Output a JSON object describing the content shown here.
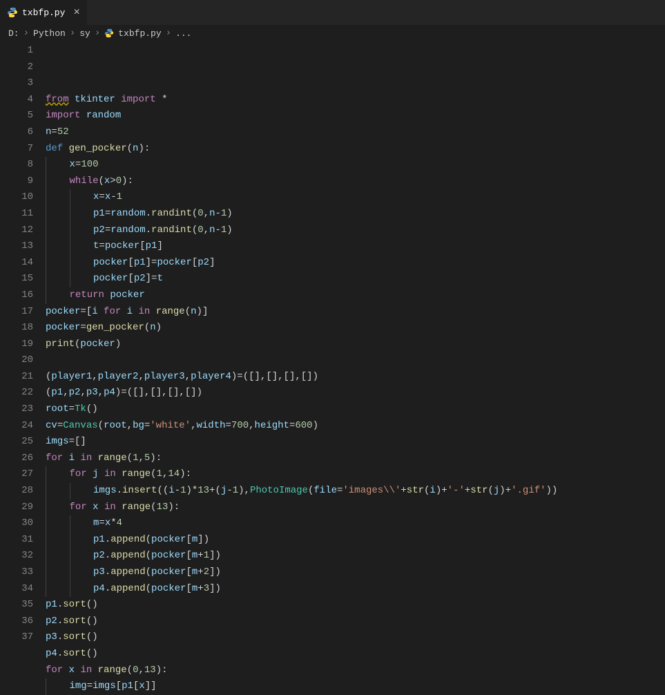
{
  "tab": {
    "filename": "txbfp.py",
    "close_glyph": "×"
  },
  "breadcrumb": {
    "parts": [
      "D:",
      "Python",
      "sy",
      "txbfp.py",
      "..."
    ],
    "sep": "›"
  },
  "gutter_start": 1,
  "gutter_end": 37,
  "code_lines": [
    [
      [
        "kw squig",
        "from"
      ],
      [
        "op",
        " "
      ],
      [
        "var",
        "tkinter"
      ],
      [
        "op",
        " "
      ],
      [
        "kw",
        "import"
      ],
      [
        "op",
        " "
      ],
      [
        "op",
        "*"
      ]
    ],
    [
      [
        "kw",
        "import"
      ],
      [
        "op",
        " "
      ],
      [
        "var",
        "random"
      ]
    ],
    [
      [
        "var",
        "n"
      ],
      [
        "op",
        "="
      ],
      [
        "num",
        "52"
      ]
    ],
    [
      [
        "kw2",
        "def"
      ],
      [
        "op",
        " "
      ],
      [
        "fn",
        "gen_pocker"
      ],
      [
        "par",
        "("
      ],
      [
        "var",
        "n"
      ],
      [
        "par",
        ")"
      ],
      [
        "pun",
        ":"
      ]
    ],
    [
      [
        "ind",
        1
      ],
      [
        "var",
        "x"
      ],
      [
        "op",
        "="
      ],
      [
        "num",
        "100"
      ]
    ],
    [
      [
        "ind",
        1
      ],
      [
        "kw",
        "while"
      ],
      [
        "par",
        "("
      ],
      [
        "var",
        "x"
      ],
      [
        "op",
        ">"
      ],
      [
        "num",
        "0"
      ],
      [
        "par",
        ")"
      ],
      [
        "pun",
        ":"
      ]
    ],
    [
      [
        "ind",
        2
      ],
      [
        "var",
        "x"
      ],
      [
        "op",
        "="
      ],
      [
        "var",
        "x"
      ],
      [
        "op",
        "-"
      ],
      [
        "num",
        "1"
      ]
    ],
    [
      [
        "ind",
        2
      ],
      [
        "var",
        "p1"
      ],
      [
        "op",
        "="
      ],
      [
        "var",
        "random"
      ],
      [
        "pun",
        "."
      ],
      [
        "fn",
        "randint"
      ],
      [
        "par",
        "("
      ],
      [
        "num",
        "0"
      ],
      [
        "pun",
        ","
      ],
      [
        "var",
        "n"
      ],
      [
        "op",
        "-"
      ],
      [
        "num",
        "1"
      ],
      [
        "par",
        ")"
      ]
    ],
    [
      [
        "ind",
        2
      ],
      [
        "var",
        "p2"
      ],
      [
        "op",
        "="
      ],
      [
        "var",
        "random"
      ],
      [
        "pun",
        "."
      ],
      [
        "fn",
        "randint"
      ],
      [
        "par",
        "("
      ],
      [
        "num",
        "0"
      ],
      [
        "pun",
        ","
      ],
      [
        "var",
        "n"
      ],
      [
        "op",
        "-"
      ],
      [
        "num",
        "1"
      ],
      [
        "par",
        ")"
      ]
    ],
    [
      [
        "ind",
        2
      ],
      [
        "var",
        "t"
      ],
      [
        "op",
        "="
      ],
      [
        "var",
        "pocker"
      ],
      [
        "par",
        "["
      ],
      [
        "var",
        "p1"
      ],
      [
        "par",
        "]"
      ]
    ],
    [
      [
        "ind",
        2
      ],
      [
        "var",
        "pocker"
      ],
      [
        "par",
        "["
      ],
      [
        "var",
        "p1"
      ],
      [
        "par",
        "]"
      ],
      [
        "op",
        "="
      ],
      [
        "var",
        "pocker"
      ],
      [
        "par",
        "["
      ],
      [
        "var",
        "p2"
      ],
      [
        "par",
        "]"
      ]
    ],
    [
      [
        "ind",
        2
      ],
      [
        "var",
        "pocker"
      ],
      [
        "par",
        "["
      ],
      [
        "var",
        "p2"
      ],
      [
        "par",
        "]"
      ],
      [
        "op",
        "="
      ],
      [
        "var",
        "t"
      ]
    ],
    [
      [
        "ind",
        1
      ],
      [
        "kw",
        "return"
      ],
      [
        "op",
        " "
      ],
      [
        "var",
        "pocker"
      ]
    ],
    [
      [
        "var",
        "pocker"
      ],
      [
        "op",
        "="
      ],
      [
        "par",
        "["
      ],
      [
        "var",
        "i"
      ],
      [
        "op",
        " "
      ],
      [
        "kw",
        "for"
      ],
      [
        "op",
        " "
      ],
      [
        "var",
        "i"
      ],
      [
        "op",
        " "
      ],
      [
        "kw",
        "in"
      ],
      [
        "op",
        " "
      ],
      [
        "fn",
        "range"
      ],
      [
        "par",
        "("
      ],
      [
        "var",
        "n"
      ],
      [
        "par",
        ")"
      ],
      [
        "par",
        "]"
      ]
    ],
    [
      [
        "var",
        "pocker"
      ],
      [
        "op",
        "="
      ],
      [
        "fn",
        "gen_pocker"
      ],
      [
        "par",
        "("
      ],
      [
        "var",
        "n"
      ],
      [
        "par",
        ")"
      ]
    ],
    [
      [
        "fn",
        "print"
      ],
      [
        "par",
        "("
      ],
      [
        "var",
        "pocker"
      ],
      [
        "par",
        ")"
      ]
    ],
    [],
    [
      [
        "par",
        "("
      ],
      [
        "var",
        "player1"
      ],
      [
        "pun",
        ","
      ],
      [
        "var",
        "player2"
      ],
      [
        "pun",
        ","
      ],
      [
        "var",
        "player3"
      ],
      [
        "pun",
        ","
      ],
      [
        "var",
        "player4"
      ],
      [
        "par",
        ")"
      ],
      [
        "op",
        "="
      ],
      [
        "par",
        "("
      ],
      [
        "par",
        "["
      ],
      [
        "par",
        "]"
      ],
      [
        "pun",
        ","
      ],
      [
        "par",
        "["
      ],
      [
        "par",
        "]"
      ],
      [
        "pun",
        ","
      ],
      [
        "par",
        "["
      ],
      [
        "par",
        "]"
      ],
      [
        "pun",
        ","
      ],
      [
        "par",
        "["
      ],
      [
        "par",
        "]"
      ],
      [
        "par",
        ")"
      ]
    ],
    [
      [
        "par",
        "("
      ],
      [
        "var",
        "p1"
      ],
      [
        "pun",
        ","
      ],
      [
        "var",
        "p2"
      ],
      [
        "pun",
        ","
      ],
      [
        "var",
        "p3"
      ],
      [
        "pun",
        ","
      ],
      [
        "var",
        "p4"
      ],
      [
        "par",
        ")"
      ],
      [
        "op",
        "="
      ],
      [
        "par",
        "("
      ],
      [
        "par",
        "["
      ],
      [
        "par",
        "]"
      ],
      [
        "pun",
        ","
      ],
      [
        "par",
        "["
      ],
      [
        "par",
        "]"
      ],
      [
        "pun",
        ","
      ],
      [
        "par",
        "["
      ],
      [
        "par",
        "]"
      ],
      [
        "pun",
        ","
      ],
      [
        "par",
        "["
      ],
      [
        "par",
        "]"
      ],
      [
        "par",
        ")"
      ]
    ],
    [
      [
        "var",
        "root"
      ],
      [
        "op",
        "="
      ],
      [
        "cls",
        "Tk"
      ],
      [
        "par",
        "("
      ],
      [
        "par",
        ")"
      ]
    ],
    [
      [
        "var",
        "cv"
      ],
      [
        "op",
        "="
      ],
      [
        "cls",
        "Canvas"
      ],
      [
        "par",
        "("
      ],
      [
        "var",
        "root"
      ],
      [
        "pun",
        ","
      ],
      [
        "var",
        "bg"
      ],
      [
        "op",
        "="
      ],
      [
        "str",
        "'white'"
      ],
      [
        "pun",
        ","
      ],
      [
        "var",
        "width"
      ],
      [
        "op",
        "="
      ],
      [
        "num",
        "700"
      ],
      [
        "pun",
        ","
      ],
      [
        "var",
        "height"
      ],
      [
        "op",
        "="
      ],
      [
        "num",
        "600"
      ],
      [
        "par",
        ")"
      ]
    ],
    [
      [
        "var",
        "imgs"
      ],
      [
        "op",
        "="
      ],
      [
        "par",
        "["
      ],
      [
        "par",
        "]"
      ]
    ],
    [
      [
        "kw",
        "for"
      ],
      [
        "op",
        " "
      ],
      [
        "var",
        "i"
      ],
      [
        "op",
        " "
      ],
      [
        "kw",
        "in"
      ],
      [
        "op",
        " "
      ],
      [
        "fn",
        "range"
      ],
      [
        "par",
        "("
      ],
      [
        "num",
        "1"
      ],
      [
        "pun",
        ","
      ],
      [
        "num",
        "5"
      ],
      [
        "par",
        ")"
      ],
      [
        "pun",
        ":"
      ]
    ],
    [
      [
        "ind",
        1
      ],
      [
        "kw",
        "for"
      ],
      [
        "op",
        " "
      ],
      [
        "var",
        "j"
      ],
      [
        "op",
        " "
      ],
      [
        "kw",
        "in"
      ],
      [
        "op",
        " "
      ],
      [
        "fn",
        "range"
      ],
      [
        "par",
        "("
      ],
      [
        "num",
        "1"
      ],
      [
        "pun",
        ","
      ],
      [
        "num",
        "14"
      ],
      [
        "par",
        ")"
      ],
      [
        "pun",
        ":"
      ]
    ],
    [
      [
        "ind",
        2
      ],
      [
        "var",
        "imgs"
      ],
      [
        "pun",
        "."
      ],
      [
        "fn",
        "insert"
      ],
      [
        "par",
        "("
      ],
      [
        "par",
        "("
      ],
      [
        "var",
        "i"
      ],
      [
        "op",
        "-"
      ],
      [
        "num",
        "1"
      ],
      [
        "par",
        ")"
      ],
      [
        "op",
        "*"
      ],
      [
        "num",
        "13"
      ],
      [
        "op",
        "+"
      ],
      [
        "par",
        "("
      ],
      [
        "var",
        "j"
      ],
      [
        "op",
        "-"
      ],
      [
        "num",
        "1"
      ],
      [
        "par",
        ")"
      ],
      [
        "pun",
        ","
      ],
      [
        "cls",
        "PhotoImage"
      ],
      [
        "par",
        "("
      ],
      [
        "var",
        "file"
      ],
      [
        "op",
        "="
      ],
      [
        "str",
        "'images\\\\'"
      ],
      [
        "op",
        "+"
      ],
      [
        "fn",
        "str"
      ],
      [
        "par",
        "("
      ],
      [
        "var",
        "i"
      ],
      [
        "par",
        ")"
      ],
      [
        "op",
        "+"
      ],
      [
        "str",
        "'-'"
      ],
      [
        "op",
        "+"
      ],
      [
        "fn",
        "str"
      ],
      [
        "par",
        "("
      ],
      [
        "var",
        "j"
      ],
      [
        "par",
        ")"
      ],
      [
        "op",
        "+"
      ],
      [
        "str",
        "'.gif'"
      ],
      [
        "par",
        ")"
      ],
      [
        "par",
        ")"
      ]
    ],
    [
      [
        "ind",
        1
      ],
      [
        "kw",
        "for"
      ],
      [
        "op",
        " "
      ],
      [
        "var",
        "x"
      ],
      [
        "op",
        " "
      ],
      [
        "kw",
        "in"
      ],
      [
        "op",
        " "
      ],
      [
        "fn",
        "range"
      ],
      [
        "par",
        "("
      ],
      [
        "num",
        "13"
      ],
      [
        "par",
        ")"
      ],
      [
        "pun",
        ":"
      ]
    ],
    [
      [
        "ind",
        2
      ],
      [
        "var",
        "m"
      ],
      [
        "op",
        "="
      ],
      [
        "var",
        "x"
      ],
      [
        "op",
        "*"
      ],
      [
        "num",
        "4"
      ]
    ],
    [
      [
        "ind",
        2
      ],
      [
        "var",
        "p1"
      ],
      [
        "pun",
        "."
      ],
      [
        "fn",
        "append"
      ],
      [
        "par",
        "("
      ],
      [
        "var",
        "pocker"
      ],
      [
        "par",
        "["
      ],
      [
        "var",
        "m"
      ],
      [
        "par",
        "]"
      ],
      [
        "par",
        ")"
      ]
    ],
    [
      [
        "ind",
        2
      ],
      [
        "var",
        "p2"
      ],
      [
        "pun",
        "."
      ],
      [
        "fn",
        "append"
      ],
      [
        "par",
        "("
      ],
      [
        "var",
        "pocker"
      ],
      [
        "par",
        "["
      ],
      [
        "var",
        "m"
      ],
      [
        "op",
        "+"
      ],
      [
        "num",
        "1"
      ],
      [
        "par",
        "]"
      ],
      [
        "par",
        ")"
      ]
    ],
    [
      [
        "ind",
        2
      ],
      [
        "var",
        "p3"
      ],
      [
        "pun",
        "."
      ],
      [
        "fn",
        "append"
      ],
      [
        "par",
        "("
      ],
      [
        "var",
        "pocker"
      ],
      [
        "par",
        "["
      ],
      [
        "var",
        "m"
      ],
      [
        "op",
        "+"
      ],
      [
        "num",
        "2"
      ],
      [
        "par",
        "]"
      ],
      [
        "par",
        ")"
      ]
    ],
    [
      [
        "ind",
        2
      ],
      [
        "var",
        "p4"
      ],
      [
        "pun",
        "."
      ],
      [
        "fn",
        "append"
      ],
      [
        "par",
        "("
      ],
      [
        "var",
        "pocker"
      ],
      [
        "par",
        "["
      ],
      [
        "var",
        "m"
      ],
      [
        "op",
        "+"
      ],
      [
        "num",
        "3"
      ],
      [
        "par",
        "]"
      ],
      [
        "par",
        ")"
      ]
    ],
    [
      [
        "var",
        "p1"
      ],
      [
        "pun",
        "."
      ],
      [
        "fn",
        "sort"
      ],
      [
        "par",
        "("
      ],
      [
        "par",
        ")"
      ]
    ],
    [
      [
        "var",
        "p2"
      ],
      [
        "pun",
        "."
      ],
      [
        "fn",
        "sort"
      ],
      [
        "par",
        "("
      ],
      [
        "par",
        ")"
      ]
    ],
    [
      [
        "var",
        "p3"
      ],
      [
        "pun",
        "."
      ],
      [
        "fn",
        "sort"
      ],
      [
        "par",
        "("
      ],
      [
        "par",
        ")"
      ]
    ],
    [
      [
        "var",
        "p4"
      ],
      [
        "pun",
        "."
      ],
      [
        "fn",
        "sort"
      ],
      [
        "par",
        "("
      ],
      [
        "par",
        ")"
      ]
    ],
    [
      [
        "kw",
        "for"
      ],
      [
        "op",
        " "
      ],
      [
        "var",
        "x"
      ],
      [
        "op",
        " "
      ],
      [
        "kw",
        "in"
      ],
      [
        "op",
        " "
      ],
      [
        "fn",
        "range"
      ],
      [
        "par",
        "("
      ],
      [
        "num",
        "0"
      ],
      [
        "pun",
        ","
      ],
      [
        "num",
        "13"
      ],
      [
        "par",
        ")"
      ],
      [
        "pun",
        ":"
      ]
    ],
    [
      [
        "ind",
        1
      ],
      [
        "var",
        "img"
      ],
      [
        "op",
        "="
      ],
      [
        "var",
        "imgs"
      ],
      [
        "par",
        "["
      ],
      [
        "var",
        "p1"
      ],
      [
        "par",
        "["
      ],
      [
        "var",
        "x"
      ],
      [
        "par",
        "]"
      ],
      [
        "par",
        "]"
      ]
    ]
  ]
}
